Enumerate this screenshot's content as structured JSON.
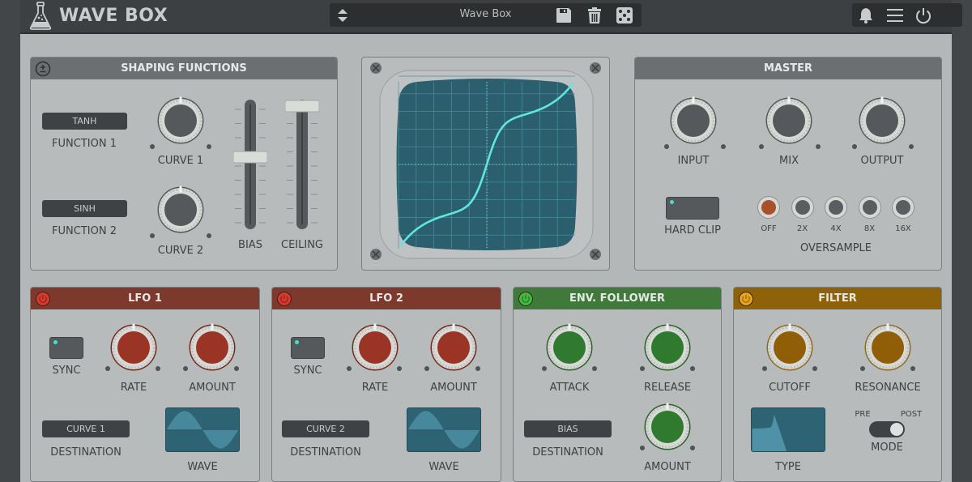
{
  "app": {
    "title": "WAVE BOX"
  },
  "preset": {
    "name": "Wave Box"
  },
  "icons": {
    "logo": "flask-icon",
    "preset_nav": "up-down-arrows-icon",
    "save": "floppy-disk-icon",
    "delete": "trash-icon",
    "random": "dice-icon",
    "notifications": "bell-icon",
    "menu": "hamburger-menu-icon",
    "power": "power-icon",
    "shaping_toggle": "plus-minus-icon"
  },
  "colors": {
    "lfo": "#7d3a2c",
    "env_follower": "#3f7a3a",
    "filter": "#8d6208",
    "screen": "#2d6373",
    "trace": "#5fe6e0"
  },
  "shaping": {
    "title": "SHAPING FUNCTIONS",
    "function1": {
      "value": "TANH",
      "label": "FUNCTION 1"
    },
    "function2": {
      "value": "SINH",
      "label": "FUNCTION 2"
    },
    "curve1_label": "CURVE 1",
    "curve2_label": "CURVE 2",
    "bias": {
      "label": "BIAS",
      "value": 0.55
    },
    "ceiling": {
      "label": "CEILING",
      "value": 1.0
    }
  },
  "master": {
    "title": "MASTER",
    "knobs": [
      "INPUT",
      "MIX",
      "OUTPUT"
    ],
    "hard_clip": "HARD CLIP",
    "oversample": {
      "label": "OVERSAMPLE",
      "options": [
        "OFF",
        "2X",
        "4X",
        "8X",
        "16X"
      ],
      "selected": "OFF"
    }
  },
  "lfo1": {
    "title": "LFO 1",
    "sync": "SYNC",
    "rate": "RATE",
    "amount": "AMOUNT",
    "destination_value": "CURVE 1",
    "destination_label": "DESTINATION",
    "wave": "WAVE"
  },
  "lfo2": {
    "title": "LFO 2",
    "sync": "SYNC",
    "rate": "RATE",
    "amount": "AMOUNT",
    "destination_value": "CURVE 2",
    "destination_label": "DESTINATION",
    "wave": "WAVE"
  },
  "env": {
    "title": "ENV. FOLLOWER",
    "attack": "ATTACK",
    "release": "RELEASE",
    "amount": "AMOUNT",
    "destination_value": "BIAS",
    "destination_label": "DESTINATION"
  },
  "filter": {
    "title": "FILTER",
    "cutoff": "CUTOFF",
    "resonance": "RESONANCE",
    "type": "TYPE",
    "mode_label": "MODE",
    "mode_pre": "PRE",
    "mode_post": "POST",
    "mode_value": "POST"
  }
}
